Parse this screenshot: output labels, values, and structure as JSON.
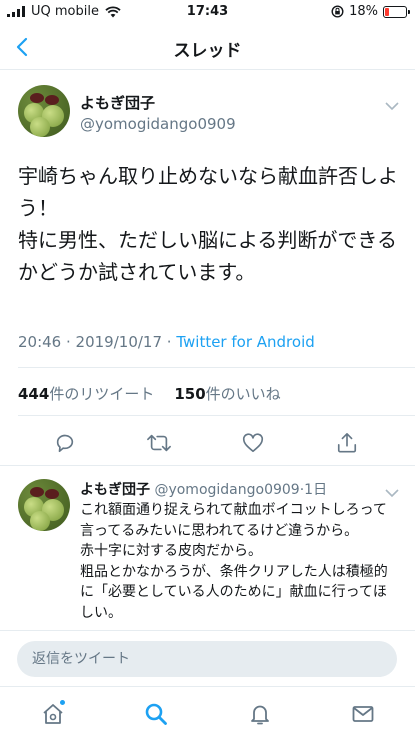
{
  "status_bar": {
    "carrier": "UQ mobile",
    "time": "17:43",
    "battery_text": "18%",
    "battery_level": 0.18,
    "icons": [
      "signal-icon",
      "wifi-icon",
      "rotation-lock-icon",
      "battery-icon"
    ]
  },
  "nav": {
    "back_icon": "chevron-left-icon",
    "title": "スレッド"
  },
  "main_tweet": {
    "display_name": "よもぎ団子",
    "handle": "@yomogidango0909",
    "text_lines": [
      "宇崎ちゃん取り止めないなら献血許否しよう！",
      "特に男性、ただしい脳による判断ができるかどうか試されています。"
    ],
    "time": "20:46",
    "date": "2019/10/17",
    "client": "Twitter for Android",
    "retweet_count": "444",
    "retweet_label": "件のリツイート",
    "like_count": "150",
    "like_label": "件のいいね",
    "actions": [
      "reply-icon",
      "retweet-icon",
      "like-icon",
      "share-icon"
    ]
  },
  "reply_tweet": {
    "display_name": "よもぎ団子",
    "handle": "@yomogidango0909",
    "age": "1日",
    "text_lines": [
      "これ額面通り捉えられて献血ボイコットしろって言ってるみたいに思われてるけど違うから。",
      "赤十字に対する皮肉だから。",
      "粗品とかなかろうが、条件クリアした人は積極的に「必要としている人のために」献血に行ってほしい。"
    ]
  },
  "reply_bar": {
    "placeholder": "返信をツイート"
  },
  "tab_bar": {
    "tabs": [
      "home-icon",
      "search-icon",
      "notifications-icon",
      "messages-icon"
    ],
    "active": "search-icon",
    "accent": "#1da1f2"
  },
  "colors": {
    "accent": "#1da1f2",
    "text": "#14171a",
    "secondary": "#657786",
    "divider": "#e6ecf0"
  }
}
